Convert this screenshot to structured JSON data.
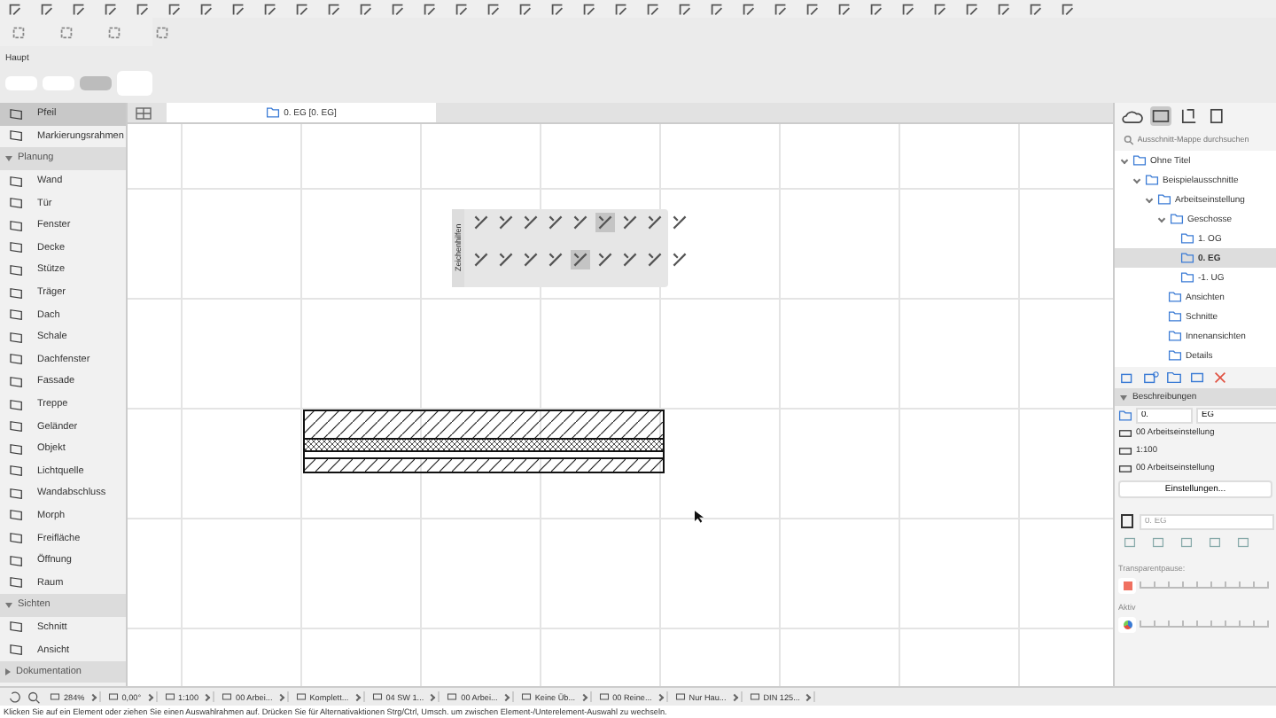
{
  "toolbar": {
    "label": "Haupt"
  },
  "view_tab": {
    "label": "0. EG [0. EG]",
    "selected": true
  },
  "toolbox": {
    "items": [
      {
        "kind": "tool",
        "label": "Pfeil",
        "selected": true
      },
      {
        "kind": "tool",
        "label": "Markierungsrahmen",
        "selected": false
      },
      {
        "kind": "section",
        "label": "Planung",
        "expanded": true
      },
      {
        "kind": "tool",
        "label": "Wand",
        "selected": false
      },
      {
        "kind": "tool",
        "label": "Tür",
        "selected": false
      },
      {
        "kind": "tool",
        "label": "Fenster",
        "selected": false
      },
      {
        "kind": "tool",
        "label": "Decke",
        "selected": false
      },
      {
        "kind": "tool",
        "label": "Stütze",
        "selected": false
      },
      {
        "kind": "tool",
        "label": "Träger",
        "selected": false
      },
      {
        "kind": "tool",
        "label": "Dach",
        "selected": false
      },
      {
        "kind": "tool",
        "label": "Schale",
        "selected": false
      },
      {
        "kind": "tool",
        "label": "Dachfenster",
        "selected": false
      },
      {
        "kind": "tool",
        "label": "Fassade",
        "selected": false
      },
      {
        "kind": "tool",
        "label": "Treppe",
        "selected": false
      },
      {
        "kind": "tool",
        "label": "Geländer",
        "selected": false
      },
      {
        "kind": "tool",
        "label": "Objekt",
        "selected": false
      },
      {
        "kind": "tool",
        "label": "Lichtquelle",
        "selected": false
      },
      {
        "kind": "tool",
        "label": "Wandabschluss",
        "selected": false
      },
      {
        "kind": "tool",
        "label": "Morph",
        "selected": false
      },
      {
        "kind": "tool",
        "label": "Freifläche",
        "selected": false
      },
      {
        "kind": "tool",
        "label": "Öffnung",
        "selected": false
      },
      {
        "kind": "tool",
        "label": "Raum",
        "selected": false
      },
      {
        "kind": "section",
        "label": "Sichten",
        "expanded": true
      },
      {
        "kind": "tool",
        "label": "Schnitt",
        "selected": false
      },
      {
        "kind": "tool",
        "label": "Ansicht",
        "selected": false
      },
      {
        "kind": "section",
        "label": "Dokumentation",
        "expanded": false
      }
    ]
  },
  "palette": {
    "title": "Zeichenhilfen"
  },
  "navigator": {
    "search": {
      "placeholder": "Ausschnitt-Mappe durchsuchen"
    },
    "tree": [
      {
        "label": "Ohne Titel",
        "expanded": true,
        "selected": false,
        "children": [
          {
            "label": "Beispielausschnitte",
            "expanded": true,
            "selected": false,
            "children": [
              {
                "label": "Arbeitseinstellung",
                "expanded": true,
                "selected": false,
                "children": [
                  {
                    "label": "Geschosse",
                    "expanded": true,
                    "selected": false,
                    "children": [
                      {
                        "label": "1. OG",
                        "selected": false
                      },
                      {
                        "label": "0. EG",
                        "selected": true
                      },
                      {
                        "label": "-1. UG",
                        "selected": false
                      }
                    ]
                  },
                  {
                    "label": "Ansichten",
                    "selected": false
                  },
                  {
                    "label": "Schnitte",
                    "selected": false
                  },
                  {
                    "label": "Innenansichten",
                    "selected": false
                  },
                  {
                    "label": "Details",
                    "selected": false
                  }
                ]
              }
            ]
          }
        ]
      }
    ]
  },
  "properties": {
    "header": "Beschreibungen",
    "number": "0.",
    "name": "EG",
    "rows": [
      "00 Arbeitseinstellung",
      "1:100",
      "00 Arbeitseinstellung"
    ],
    "button": "Einstellungen...",
    "view_field": "0. EG",
    "transparency_label": "Transparentpause:",
    "active_label": "Aktiv"
  },
  "status_bar": {
    "items": [
      "284%",
      "0,00°",
      "1:100",
      "00 Arbei...",
      "Komplett...",
      "04 SW 1...",
      "00 Arbei...",
      "Keine Üb...",
      "00 Reine...",
      "Nur Hau...",
      "DIN 125..."
    ]
  },
  "hint": "Klicken Sie auf ein Element oder ziehen Sie einen Auswahlrahmen auf. Drücken Sie für Alternativaktionen Strg/Ctrl, Umsch. um zwischen Element-/Unterelement-Auswahl zu wechseln."
}
